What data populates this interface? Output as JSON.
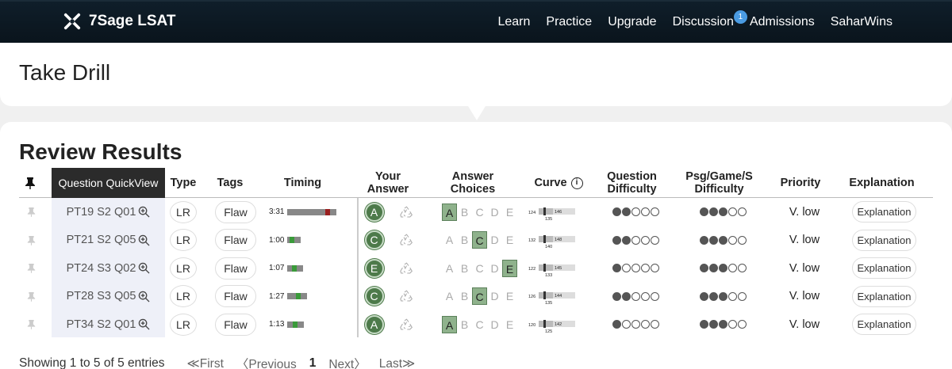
{
  "brand": "7Sage LSAT",
  "nav": [
    {
      "label": "Learn"
    },
    {
      "label": "Practice"
    },
    {
      "label": "Upgrade"
    },
    {
      "label": "Discussion",
      "badge": "1"
    },
    {
      "label": "Admissions"
    },
    {
      "label": "SaharWins"
    }
  ],
  "page_title": "Take Drill",
  "section_title": "Review Results",
  "headers": {
    "quickview": "Question QuickView",
    "type": "Type",
    "tags": "Tags",
    "timing": "Timing",
    "your_answer": "Your Answer",
    "answer_choices": "Answer Choices",
    "curve": "Curve",
    "q_difficulty": "Question Difficulty",
    "psg_difficulty": "Psg/Game/S Difficulty",
    "priority": "Priority",
    "explanation": "Explanation"
  },
  "choices_letters": [
    "A",
    "B",
    "C",
    "D",
    "E"
  ],
  "rows": [
    {
      "qid": "PT19 S2 Q01",
      "type": "LR",
      "tag": "Flaw",
      "time": "3:31",
      "timing_fraction": 1.0,
      "your_answer": "A",
      "correct": "A",
      "curve": [
        "124",
        "135",
        "146"
      ],
      "q_diff": 2,
      "p_diff": 3,
      "priority": "V. low",
      "explanation": "Explanation"
    },
    {
      "qid": "PT21 S2 Q05",
      "type": "LR",
      "tag": "Flaw",
      "time": "1:00",
      "timing_fraction": 0.28,
      "your_answer": "C",
      "correct": "C",
      "curve": [
        "132",
        "140",
        "148"
      ],
      "q_diff": 2,
      "p_diff": 3,
      "priority": "V. low",
      "explanation": "Explanation"
    },
    {
      "qid": "PT24 S3 Q02",
      "type": "LR",
      "tag": "Flaw",
      "time": "1:07",
      "timing_fraction": 0.32,
      "your_answer": "E",
      "correct": "E",
      "curve": [
        "122",
        "133",
        "145"
      ],
      "q_diff": 1,
      "p_diff": 3,
      "priority": "V. low",
      "explanation": "Explanation"
    },
    {
      "qid": "PT28 S3 Q05",
      "type": "LR",
      "tag": "Flaw",
      "time": "1:27",
      "timing_fraction": 0.41,
      "your_answer": "C",
      "correct": "C",
      "curve": [
        "126",
        "135",
        "144"
      ],
      "q_diff": 2,
      "p_diff": 3,
      "priority": "V. low",
      "explanation": "Explanation"
    },
    {
      "qid": "PT34 S2 Q01",
      "type": "LR",
      "tag": "Flaw",
      "time": "1:13",
      "timing_fraction": 0.34,
      "your_answer": "A",
      "correct": "A",
      "curve": [
        "120",
        "125",
        "142"
      ],
      "q_diff": 1,
      "p_diff": 3,
      "priority": "V. low",
      "explanation": "Explanation"
    }
  ],
  "footer": {
    "showing": "Showing 1 to 5 of 5 entries",
    "first": "≪First",
    "previous": "〈Previous",
    "page": "1",
    "next": "Next〉",
    "last": "Last≫"
  },
  "colors": {
    "nav_bg": "#0f1e2a",
    "answer_green": "#4d7a4a",
    "choice_selected": "#8fb28c",
    "badge": "#4a9be2"
  }
}
